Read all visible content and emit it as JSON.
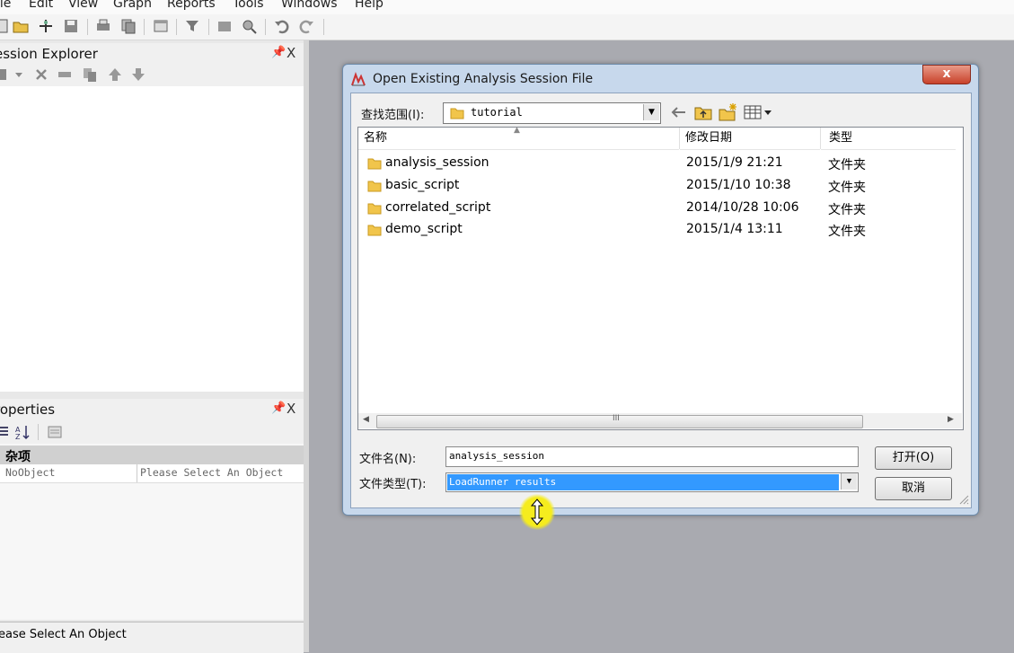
{
  "menu": [
    "ile",
    "Edit",
    "View",
    "Graph",
    "Reports",
    "Tools",
    "Windows",
    "Help"
  ],
  "session_explorer": {
    "title": "ession Explorer",
    "pin": "📌",
    "close": "X"
  },
  "properties": {
    "title": "roperties",
    "pin": "📌",
    "close": "X",
    "category": "杂项",
    "prop_name": "NoObject",
    "prop_value": "Please Select An Object"
  },
  "status_bar": {
    "text": "ease Select An Object"
  },
  "dialog": {
    "title": "Open Existing Analysis Session File",
    "close": "x",
    "look_in_label": "查找范围(I):",
    "look_in_value": "tutorial",
    "columns": [
      "名称",
      "修改日期",
      "类型"
    ],
    "files": [
      {
        "name": "analysis_session",
        "modified": "2015/1/9 21:21",
        "type": "文件夹"
      },
      {
        "name": "basic_script",
        "modified": "2015/1/10 10:38",
        "type": "文件夹"
      },
      {
        "name": "correlated_script",
        "modified": "2014/10/28 10:06",
        "type": "文件夹"
      },
      {
        "name": "demo_script",
        "modified": "2015/1/4 13:11",
        "type": "文件夹"
      }
    ],
    "file_name_label": "文件名(N):",
    "file_name_value": "analysis_session",
    "file_type_label": "文件类型(T):",
    "file_type_value": "LoadRunner results",
    "open_button": "打开(O)",
    "cancel_button": "取消",
    "scroll_grip": "III"
  }
}
